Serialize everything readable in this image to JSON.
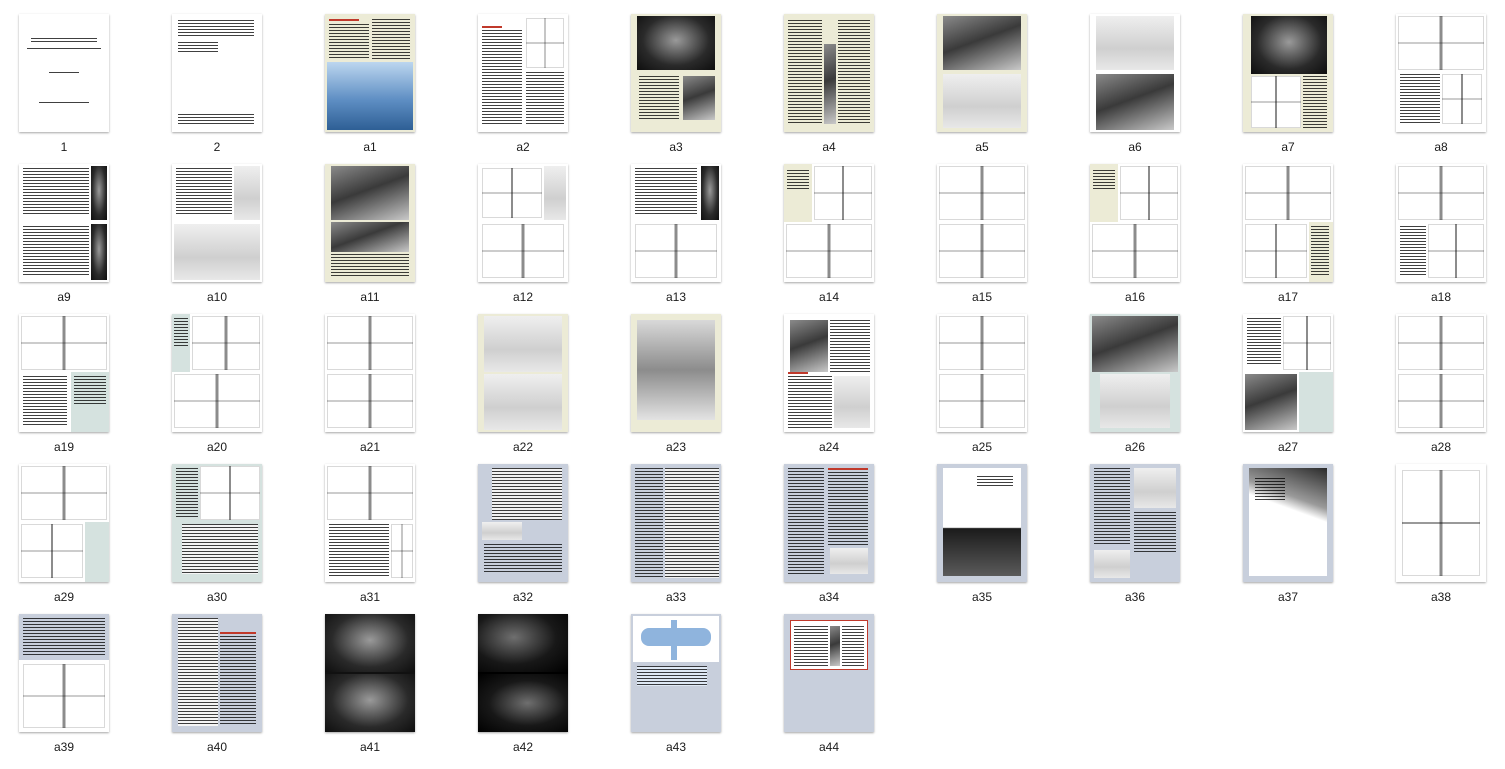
{
  "colors": {
    "paper_white": "#ffffff",
    "paper_cream": "#ecebd6",
    "paper_slate": "#c8cfdc",
    "paper_teal": "#d5e2df",
    "page_blue": "#8fb4dd",
    "accent_red": "#c0392b"
  },
  "pages": [
    {
      "label": "1",
      "style": "title"
    },
    {
      "label": "2",
      "style": "text-sparse"
    },
    {
      "label": "a1",
      "style": "cover"
    },
    {
      "label": "a2",
      "style": "text-diagram"
    },
    {
      "label": "a3",
      "style": "photo-cream"
    },
    {
      "label": "a4",
      "style": "text-cream"
    },
    {
      "label": "a5",
      "style": "photo-cream-2"
    },
    {
      "label": "a6",
      "style": "photo-white-2"
    },
    {
      "label": "a7",
      "style": "photo-table"
    },
    {
      "label": "a8",
      "style": "drawing-table"
    },
    {
      "label": "a9",
      "style": "table-photo"
    },
    {
      "label": "a10",
      "style": "text-photo"
    },
    {
      "label": "a11",
      "style": "photo-cream-text"
    },
    {
      "label": "a12",
      "style": "drawing-photo"
    },
    {
      "label": "a13",
      "style": "chart-drawing"
    },
    {
      "label": "a14",
      "style": "drawing-cream"
    },
    {
      "label": "a15",
      "style": "drawing-white"
    },
    {
      "label": "a16",
      "style": "drawing-cream"
    },
    {
      "label": "a17",
      "style": "drawing-cream-right"
    },
    {
      "label": "a18",
      "style": "drawing-text"
    },
    {
      "label": "a19",
      "style": "drawing-text-teal"
    },
    {
      "label": "a20",
      "style": "drawing-teal"
    },
    {
      "label": "a21",
      "style": "drawing-white"
    },
    {
      "label": "a22",
      "style": "model-photo"
    },
    {
      "label": "a23",
      "style": "model-photo-single"
    },
    {
      "label": "a24",
      "style": "text-photo-red"
    },
    {
      "label": "a25",
      "style": "sketch"
    },
    {
      "label": "a26",
      "style": "photo-teal"
    },
    {
      "label": "a27",
      "style": "drawing-photo-teal"
    },
    {
      "label": "a28",
      "style": "sketch-2"
    },
    {
      "label": "a29",
      "style": "drawing-teal-2"
    },
    {
      "label": "a30",
      "style": "drawing-table-teal"
    },
    {
      "label": "a31",
      "style": "drawing-table-teal-2"
    },
    {
      "label": "a32",
      "style": "table-slate"
    },
    {
      "label": "a33",
      "style": "table-slate-2"
    },
    {
      "label": "a34",
      "style": "text-slate"
    },
    {
      "label": "a35",
      "style": "cover-slate"
    },
    {
      "label": "a36",
      "style": "text-photo-slate"
    },
    {
      "label": "a37",
      "style": "cover-slate-2"
    },
    {
      "label": "a38",
      "style": "drawing-plain"
    },
    {
      "label": "a39",
      "style": "text-drawing-slate"
    },
    {
      "label": "a40",
      "style": "text-slate-2"
    },
    {
      "label": "a41",
      "style": "photo-dark"
    },
    {
      "label": "a42",
      "style": "photo-dark-2"
    },
    {
      "label": "a43",
      "style": "blue-drawing"
    },
    {
      "label": "a44",
      "style": "red-box-slate"
    }
  ]
}
